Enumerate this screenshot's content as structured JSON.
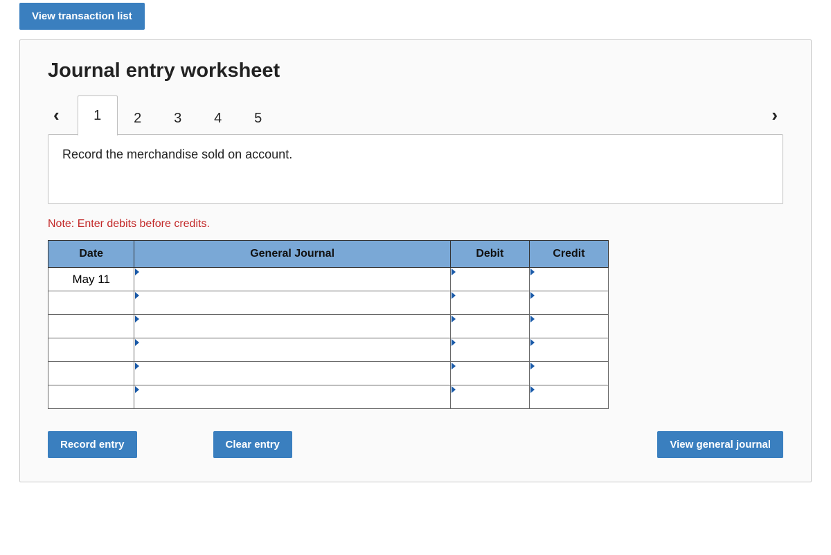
{
  "top": {
    "view_list": "View transaction list"
  },
  "panel": {
    "title": "Journal entry worksheet",
    "tabs": [
      "1",
      "2",
      "3",
      "4",
      "5"
    ],
    "active_tab_index": 0,
    "instruction": "Record the merchandise sold on account.",
    "note": "Note: Enter debits before credits."
  },
  "table": {
    "headers": {
      "date": "Date",
      "gj": "General Journal",
      "debit": "Debit",
      "credit": "Credit"
    },
    "rows": [
      {
        "date": "May 11",
        "gj": "",
        "debit": "",
        "credit": ""
      },
      {
        "date": "",
        "gj": "",
        "debit": "",
        "credit": ""
      },
      {
        "date": "",
        "gj": "",
        "debit": "",
        "credit": ""
      },
      {
        "date": "",
        "gj": "",
        "debit": "",
        "credit": ""
      },
      {
        "date": "",
        "gj": "",
        "debit": "",
        "credit": ""
      },
      {
        "date": "",
        "gj": "",
        "debit": "",
        "credit": ""
      }
    ]
  },
  "buttons": {
    "record": "Record entry",
    "clear": "Clear entry",
    "view_journal": "View general journal"
  }
}
